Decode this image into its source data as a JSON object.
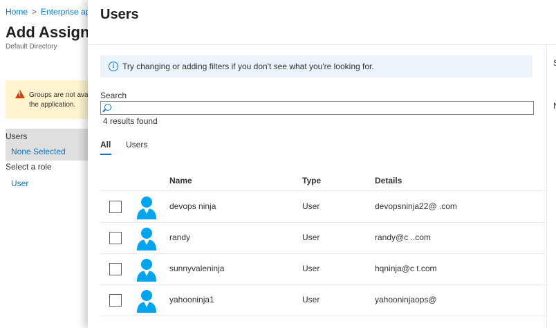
{
  "background": {
    "breadcrumb": [
      "Home",
      "Enterprise ap"
    ],
    "title": "Add Assignm",
    "subtitle": "Default Directory",
    "warning_text": "Groups are not ava\nthe application.",
    "users_label": "Users",
    "users_value": "None Selected",
    "role_label": "Select a role",
    "role_value": "User"
  },
  "blade": {
    "title": "Users",
    "info_text": "Try changing or adding filters if you don't see what you're looking for.",
    "search": {
      "label": "Search",
      "value": "",
      "placeholder": ""
    },
    "results_count": "4 results found",
    "tabs": [
      {
        "label": "All",
        "selected": true
      },
      {
        "label": "Users",
        "selected": false
      }
    ],
    "columns": [
      "Name",
      "Type",
      "Details"
    ],
    "rows": [
      {
        "name": "devops ninja",
        "type": "User",
        "details": "devopsninja22@        .com"
      },
      {
        "name": "randy",
        "type": "User",
        "details": "randy@c                                    ..com"
      },
      {
        "name": "sunnyvaleninja",
        "type": "User",
        "details": "hqninja@c                                    t.com"
      },
      {
        "name": "yahooninja1",
        "type": "User",
        "details": "yahooninjaops@"
      }
    ],
    "side_glyphs": [
      "S",
      "N"
    ]
  },
  "colors": {
    "accent": "#0078d4",
    "avatar": "#00a4ef",
    "info_bar": "#ebf3fb",
    "warning_bar": "#fff4ce"
  },
  "icons": {
    "info": "info-icon",
    "search": "search-icon",
    "warning": "warning-icon",
    "avatar": "user-avatar-icon"
  }
}
